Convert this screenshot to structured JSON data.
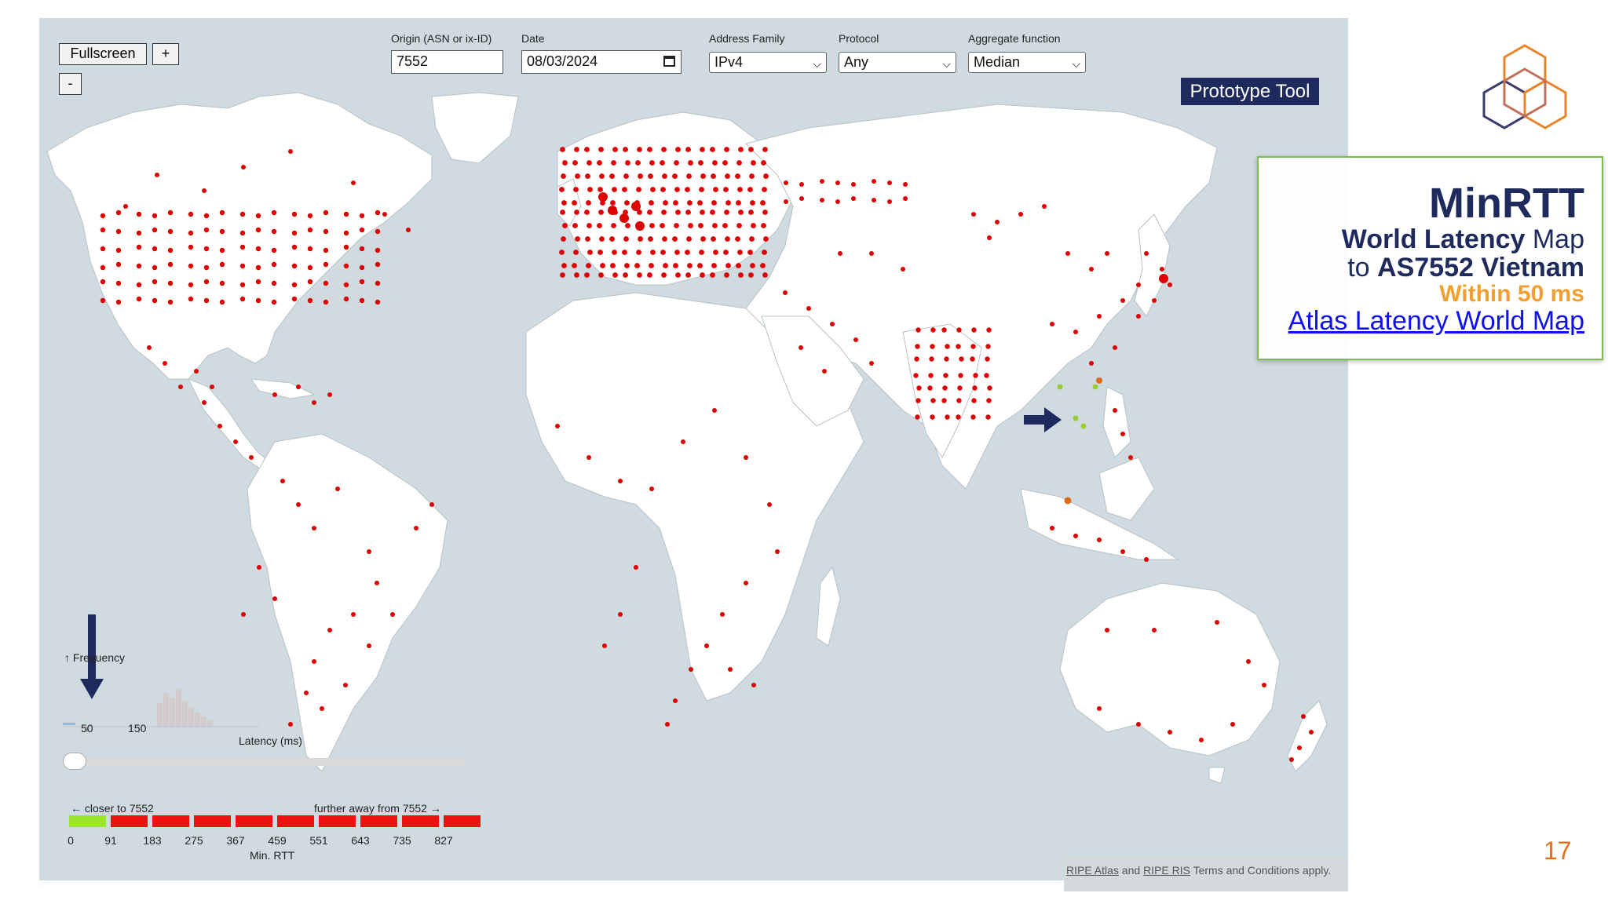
{
  "controls": {
    "fullscreen_label": "Fullscreen",
    "zoom_in_label": "+",
    "zoom_out_label": "-"
  },
  "form": {
    "origin_label": "Origin (ASN or ix-ID)",
    "origin_value": "7552",
    "date_label": "Date",
    "date_value": "08/03/2024",
    "address_family_label": "Address Family",
    "address_family_value": "IPv4",
    "protocol_label": "Protocol",
    "protocol_value": "Any",
    "aggregate_label": "Aggregate function",
    "aggregate_value": "Median"
  },
  "badge": "Prototype Tool",
  "info_box": {
    "title": "MinRTT",
    "line2_bold": "World Latency",
    "line2_rest": " Map",
    "line3_pre": "to ",
    "line3_bold": "AS7552 Vietnam",
    "line4": "Within 50 ms",
    "link": "Atlas Latency World Map"
  },
  "histogram": {
    "ylabel": "↑ Frequency",
    "xlabel": "Latency (ms)",
    "ticks": [
      "50",
      "150"
    ]
  },
  "legend": {
    "left_label": "← closer to 7552",
    "right_label": "further away from 7552 →",
    "axis_label": "Min. RTT",
    "values": [
      "0",
      "91",
      "183",
      "275",
      "367",
      "459",
      "551",
      "643",
      "735",
      "827"
    ],
    "colors": [
      "#9be52a",
      "#ee1111",
      "#ee1111",
      "#ee1111",
      "#ee1111",
      "#ee1111",
      "#ee1111",
      "#ee1111",
      "#ee1111",
      "#ee1111"
    ]
  },
  "terms": {
    "link1": "RIPE Atlas",
    "mid": " and ",
    "link2": "RIPE RIS",
    "rest": " Terms and Conditions apply."
  },
  "slide_number": "17",
  "colors": {
    "probe_red": "#dd0000",
    "probe_green": "#9ccc33",
    "probe_orange": "#e06a1a",
    "accent_navy": "#1e2a5c",
    "logo_orange": "#e8852a"
  }
}
